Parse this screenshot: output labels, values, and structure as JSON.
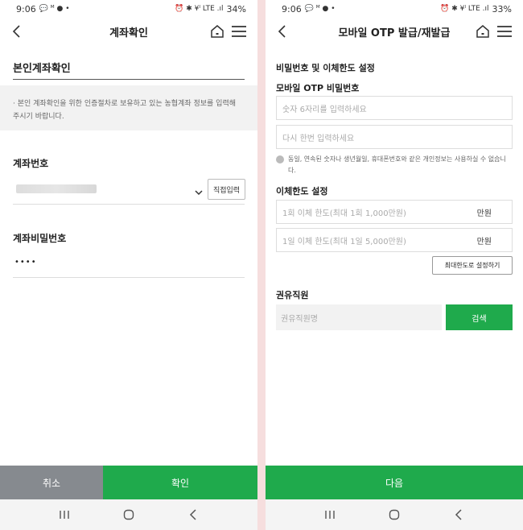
{
  "left_screen": {
    "status": {
      "time": "9:06",
      "right_icons": "⏰ ✱ ¥ᴵ LTE .ıl",
      "battery": "34%"
    },
    "appbar": {
      "title": "계좌확인"
    },
    "section_title": "본인계좌확인",
    "notice": "· 본인 계좌확인을 위한 인증절차로 보유하고 있는 농협계좌 정보를 입력해 주시기 바랍니다.",
    "account": {
      "label": "계좌번호",
      "direct_input_label": "직접입력"
    },
    "password": {
      "label": "계좌비밀번호",
      "value": "••••"
    },
    "bottom": {
      "cancel": "취소",
      "confirm": "확인"
    }
  },
  "right_screen": {
    "status": {
      "time": "9:06",
      "right_icons": "⏰ ✱ ¥ᴵ LTE .ıl",
      "battery": "33%"
    },
    "appbar": {
      "title": "모바일 OTP 발급/재발급"
    },
    "section_heading": "비밀번호 및 이체한도 설정",
    "otp": {
      "label": "모바일 OTP 비밀번호",
      "placeholder1": "숫자 6자리를 입력하세요",
      "placeholder2": "다시 한번 입력하세요",
      "info": "동일, 연속된 숫자나 생년월일, 휴대폰번호와 같은 개인정보는 사용하실 수 없습니다."
    },
    "limit": {
      "label": "이체한도 설정",
      "per_tx_placeholder": "1회 이체 한도(최대 1회 1,000만원)",
      "per_day_placeholder": "1일 이체 한도(최대 1일 5,000만원)",
      "unit": "만원",
      "max_button": "최대한도로 설정하기"
    },
    "staff": {
      "label": "권유직원",
      "placeholder": "권유직원명",
      "search_button": "검색"
    },
    "bottom": {
      "next": "다음"
    }
  },
  "colors": {
    "green": "#1faa4c",
    "gray_button": "#868a8f",
    "divider": "#f6dede"
  },
  "icons": [
    "back-arrow-icon",
    "home-icon",
    "menu-icon",
    "chevron-down-icon",
    "info-icon",
    "recent-apps-icon",
    "home-circle-icon",
    "nav-back-icon"
  ]
}
